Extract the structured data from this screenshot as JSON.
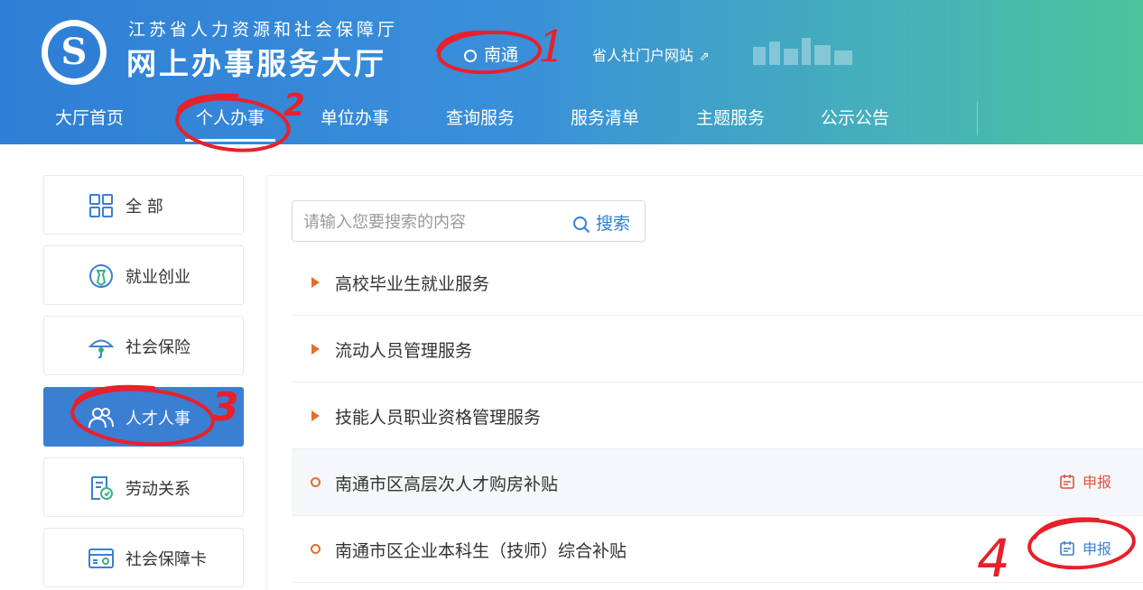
{
  "header": {
    "subtitle": "江苏省人力资源和社会保障厅",
    "title": "网上办事服务大厅",
    "city": "南通",
    "portal_link": "省人社门户网站",
    "portal_arrow": "⇗"
  },
  "nav": {
    "items": [
      {
        "label": "大厅首页"
      },
      {
        "label": "个人办事"
      },
      {
        "label": "单位办事"
      },
      {
        "label": "查询服务"
      },
      {
        "label": "服务清单"
      },
      {
        "label": "主题服务"
      },
      {
        "label": "公示公告"
      }
    ],
    "active_index": 1
  },
  "sidebar": {
    "items": [
      {
        "label": "全 部",
        "icon": "grid-icon"
      },
      {
        "label": "就业创业",
        "icon": "employment-icon"
      },
      {
        "label": "社会保险",
        "icon": "umbrella-icon"
      },
      {
        "label": "人才人事",
        "icon": "people-icon"
      },
      {
        "label": "劳动关系",
        "icon": "document-badge-icon"
      },
      {
        "label": "社会保障卡",
        "icon": "card-icon"
      }
    ],
    "active_index": 3
  },
  "search": {
    "placeholder": "请输入您要搜索的内容",
    "button_label": "搜索"
  },
  "list": {
    "items": [
      {
        "label": "高校毕业生就业服务",
        "type": "category"
      },
      {
        "label": "流动人员管理服务",
        "type": "category"
      },
      {
        "label": "技能人员职业资格管理服务",
        "type": "category"
      },
      {
        "label": "南通市区高层次人才购房补贴",
        "type": "service",
        "action": "申报"
      },
      {
        "label": "南通市区企业本科生（技师）综合补贴",
        "type": "service",
        "action": "申报"
      }
    ]
  },
  "annotations": {
    "marks": [
      "1",
      "2",
      "3",
      "4"
    ]
  },
  "colors": {
    "primary": "#2f7fd6",
    "accent": "#e0702e",
    "annotation": "#e8202a",
    "apply_red": "#e0533d"
  }
}
